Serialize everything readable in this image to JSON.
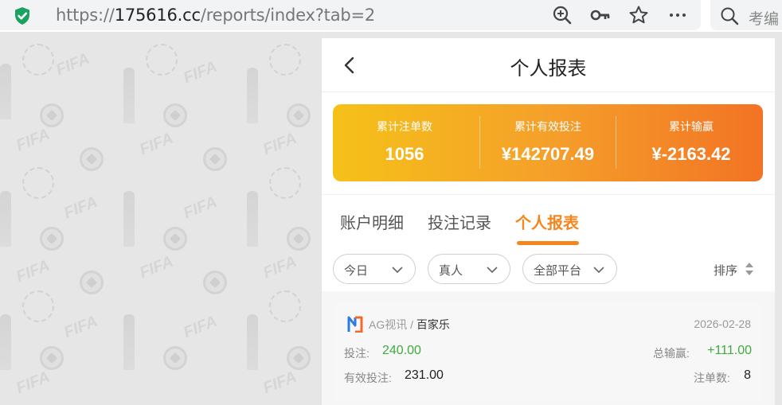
{
  "browser": {
    "url_prefix": "https://",
    "url_host": "175616.cc",
    "url_path": "/reports/index?tab=2",
    "search_placeholder": "考编"
  },
  "page": {
    "title": "个人报表"
  },
  "summary": {
    "bets_label": "累计注单数",
    "bets_value": "1056",
    "valid_label": "累计有效投注",
    "valid_value": "¥142707.49",
    "winloss_label": "累计输赢",
    "winloss_value": "¥-2163.42"
  },
  "tabs": [
    {
      "label": "账户明细",
      "active": false
    },
    {
      "label": "投注记录",
      "active": false
    },
    {
      "label": "个人报表",
      "active": true
    }
  ],
  "filters": {
    "date": "今日",
    "type": "真人",
    "platform": "全部平台",
    "sort": "排序"
  },
  "records": [
    {
      "provider": "AG视讯",
      "separator": " / ",
      "game": "百家乐",
      "date": "2026-02-28",
      "bet_label": "投注:",
      "bet_value": "240.00",
      "winloss_label": "总输赢:",
      "winloss_value": "+111.00",
      "valid_label": "有效投注:",
      "valid_value": "231.00",
      "count_label": "注单数:",
      "count_value": "8"
    }
  ],
  "colors": {
    "accent": "#f5861f",
    "positive": "#3faa3f",
    "gradient_start": "#f5c118",
    "gradient_end": "#f27324"
  },
  "background_pattern_text": "FIFA"
}
